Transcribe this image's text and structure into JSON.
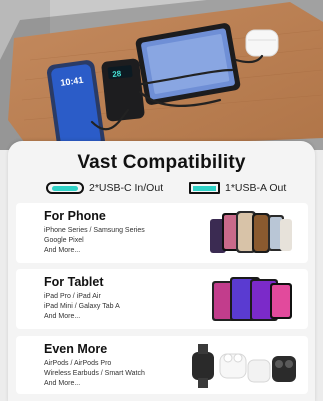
{
  "hero": {
    "phone_time": "10:41",
    "bank_display": "28"
  },
  "heading": "Vast Compatibility",
  "ports": [
    {
      "label": "2*USB-C In/Out",
      "icon": "usb-c-port-icon",
      "color": "#2fd1c6"
    },
    {
      "label": "1*USB-A Out",
      "icon": "usb-a-port-icon",
      "color": "#2fd1c6"
    }
  ],
  "sections": [
    {
      "title": "For Phone",
      "lines": [
        "iPhone Series  /  Samsung Series",
        "Google Pixel",
        "And More..."
      ]
    },
    {
      "title": "For Tablet",
      "lines": [
        "iPad Pro  /  iPad Air",
        "iPad Mini  /  Galaxy Tab A",
        "And More..."
      ]
    },
    {
      "title": "Even More",
      "lines": [
        "AirPods  /  AirPods Pro",
        "Wireless Earbuds  /  Smart Watch",
        "And More..."
      ]
    }
  ],
  "colors": {
    "accent": "#2fd1c6",
    "card": "#f4f4f4",
    "section": "#ffffff"
  }
}
